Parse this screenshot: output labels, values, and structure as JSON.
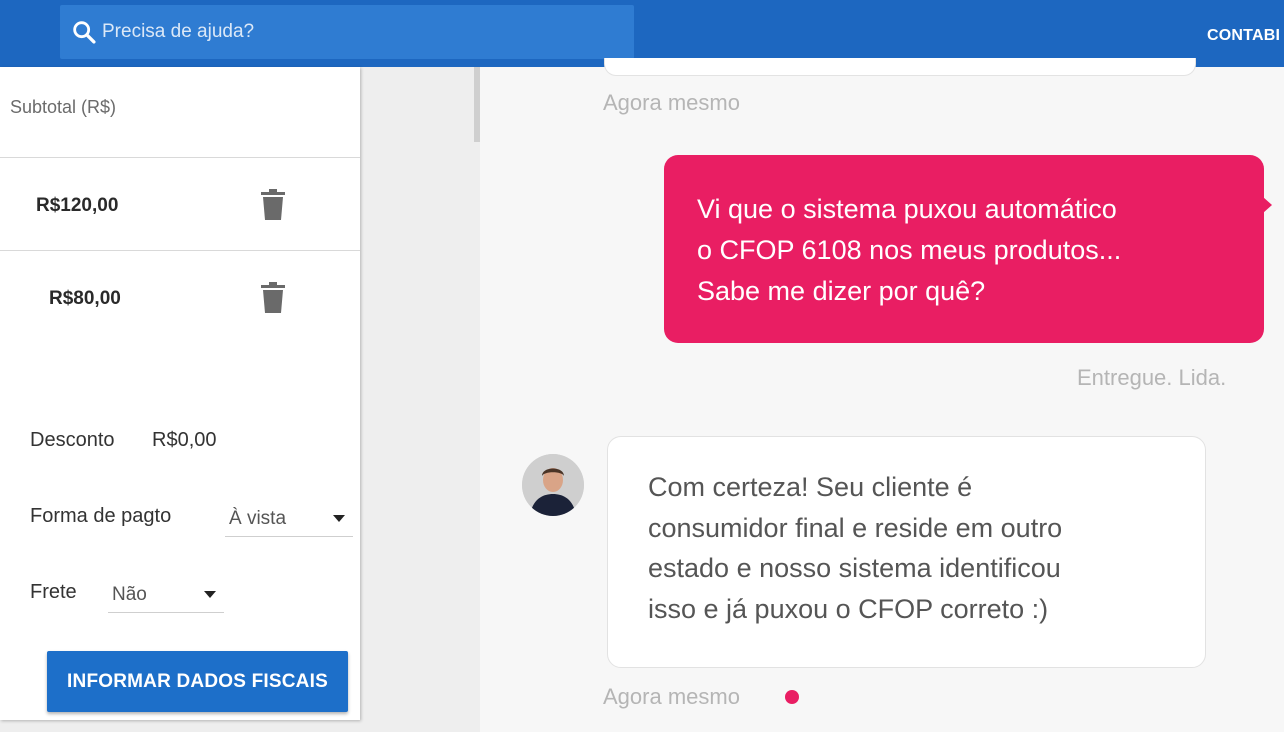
{
  "header": {
    "search_placeholder": "Precisa de ajuda?",
    "right_label": "CONTABI"
  },
  "cart": {
    "subtotal_header": "Subtotal (R$)",
    "items": [
      {
        "price": "R$120,00"
      },
      {
        "price": "R$80,00"
      }
    ],
    "discount_label": "Desconto",
    "discount_value": "R$0,00",
    "payment_label": "Forma de pagto",
    "payment_value": "À vista",
    "shipping_label": "Frete",
    "shipping_value": "Não",
    "fiscal_button": "INFORMAR DADOS FISCAIS"
  },
  "chat": {
    "previous_time": "Agora mesmo",
    "outgoing": {
      "lines": [
        "Vi que o sistema puxou automático",
        "o CFOP 6108 nos meus produtos...",
        "Sabe me dizer por quê?"
      ],
      "status": "Entregue. Lida."
    },
    "incoming": {
      "lines": [
        "Com certeza! Seu cliente é",
        "consumidor final e reside em outro",
        "estado e nosso sistema identificou",
        "isso e já puxou o CFOP correto :)"
      ],
      "time": "Agora mesmo"
    }
  },
  "colors": {
    "header": "#1d67c0",
    "accent_pink": "#e91e63",
    "button_blue": "#1d6fc9"
  }
}
